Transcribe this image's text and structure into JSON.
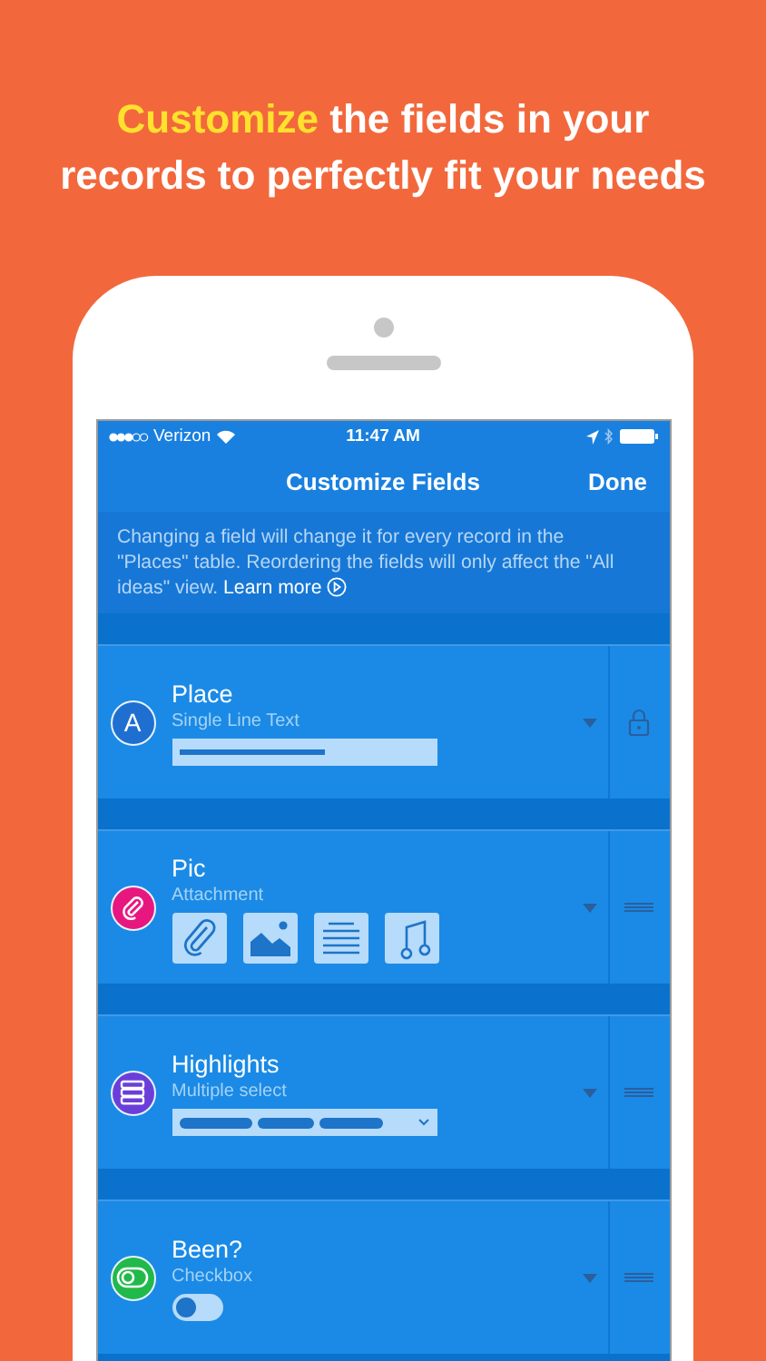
{
  "headline": {
    "highlight": "Customize",
    "rest": " the fields in your records to perfectly fit your needs"
  },
  "status_bar": {
    "carrier": "Verizon",
    "time": "11:47 AM"
  },
  "nav": {
    "title": "Customize Fields",
    "done": "Done"
  },
  "info": {
    "text": "Changing a field will change it for every record in the \"Places\" table. Reordering the fields will only affect the \"All ideas\" view.",
    "link": "Learn more"
  },
  "fields": [
    {
      "name": "Place",
      "type": "Single Line Text",
      "kind": "text",
      "color": "#1f6fd1",
      "icon_text": "A",
      "locked": true
    },
    {
      "name": "Pic",
      "type": "Attachment",
      "kind": "attachment",
      "color": "#e8177f",
      "locked": false
    },
    {
      "name": "Highlights",
      "type": "Multiple select",
      "kind": "select",
      "color": "#6a3fd9",
      "locked": false
    },
    {
      "name": "Been?",
      "type": "Checkbox",
      "kind": "checkbox",
      "color": "#22b94b",
      "locked": false,
      "checked": false
    }
  ]
}
